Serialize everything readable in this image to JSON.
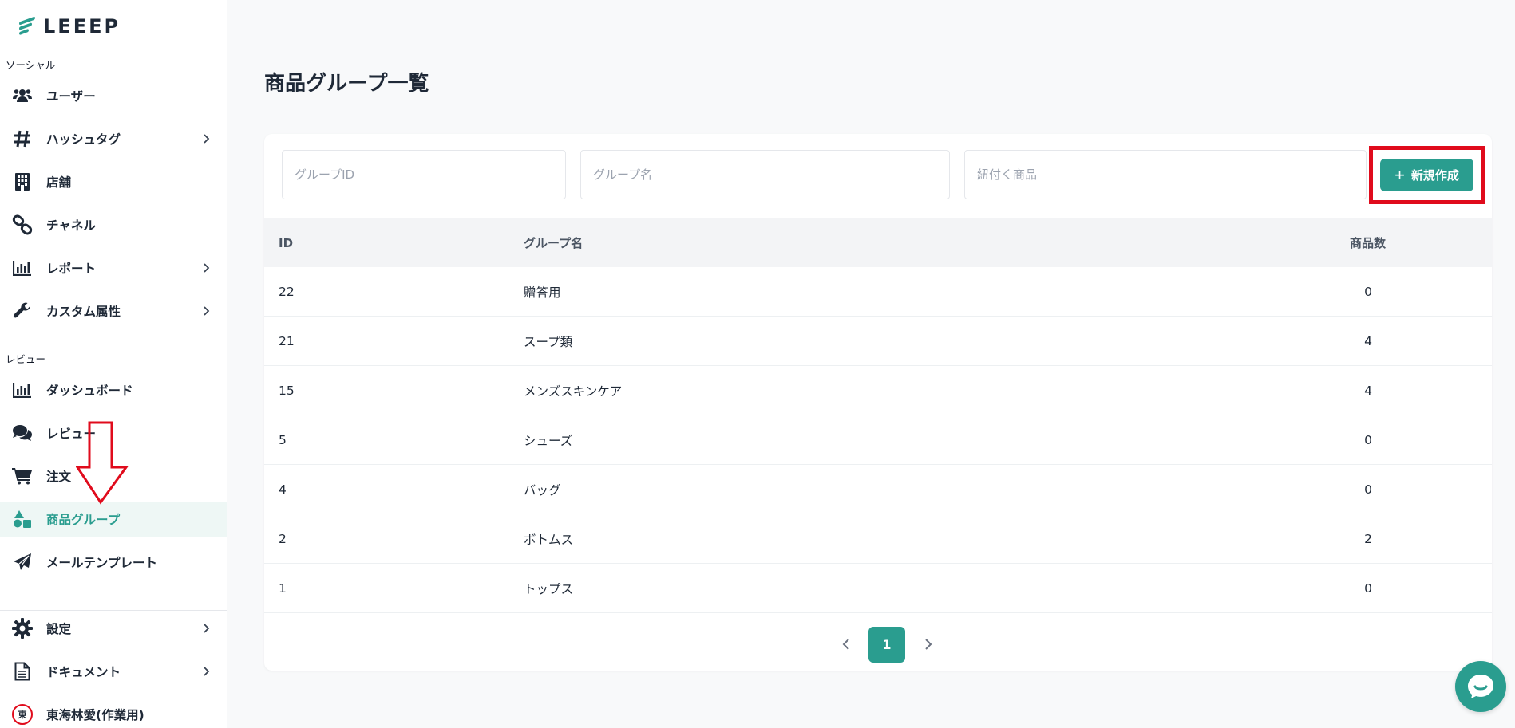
{
  "brand": {
    "name": "LEEEP",
    "accent": "#2a9d8f"
  },
  "sidebar": {
    "sections": [
      {
        "label": "ソーシャル"
      },
      {
        "label": "レビュー"
      }
    ],
    "items": [
      {
        "label": "ユーザー",
        "icon": "users-icon",
        "has_chevron": false
      },
      {
        "label": "ハッシュタグ",
        "icon": "hashtag-icon",
        "has_chevron": true
      },
      {
        "label": "店舗",
        "icon": "building-icon",
        "has_chevron": false
      },
      {
        "label": "チャネル",
        "icon": "link-icon",
        "has_chevron": false
      },
      {
        "label": "レポート",
        "icon": "bar-chart-icon",
        "has_chevron": true
      },
      {
        "label": "カスタム属性",
        "icon": "wrench-icon",
        "has_chevron": true
      },
      {
        "label": "ダッシュボード",
        "icon": "bar-chart-icon",
        "has_chevron": false
      },
      {
        "label": "レビュー",
        "icon": "comments-icon",
        "has_chevron": false
      },
      {
        "label": "注文",
        "icon": "cart-icon",
        "has_chevron": false
      },
      {
        "label": "商品グループ",
        "icon": "shapes-icon",
        "has_chevron": false,
        "active": true
      },
      {
        "label": "メールテンプレート",
        "icon": "paper-plane-icon",
        "has_chevron": false
      },
      {
        "label": "設定",
        "icon": "gear-icon",
        "has_chevron": true
      },
      {
        "label": "ドキュメント",
        "icon": "document-icon",
        "has_chevron": true
      },
      {
        "label": "東海林愛(作業用)",
        "icon": "avatar",
        "avatar_char": "東",
        "has_chevron": false
      }
    ]
  },
  "main": {
    "title": "商品グループ一覧",
    "filters": {
      "group_id_placeholder": "グループID",
      "group_name_placeholder": "グループ名",
      "product_placeholder": "紐付く商品"
    },
    "new_button_label": "新規作成",
    "table": {
      "columns": [
        "ID",
        "グループ名",
        "商品数"
      ],
      "rows": [
        {
          "id": "22",
          "name": "贈答用",
          "count": "0"
        },
        {
          "id": "21",
          "name": "スープ類",
          "count": "4"
        },
        {
          "id": "15",
          "name": "メンズスキンケア",
          "count": "4"
        },
        {
          "id": "5",
          "name": "シューズ",
          "count": "0"
        },
        {
          "id": "4",
          "name": "バッグ",
          "count": "0"
        },
        {
          "id": "2",
          "name": "ボトムス",
          "count": "2"
        },
        {
          "id": "1",
          "name": "トップス",
          "count": "0"
        }
      ]
    },
    "pagination": {
      "current_page": "1"
    }
  },
  "annotation_color": "#e00b1c"
}
